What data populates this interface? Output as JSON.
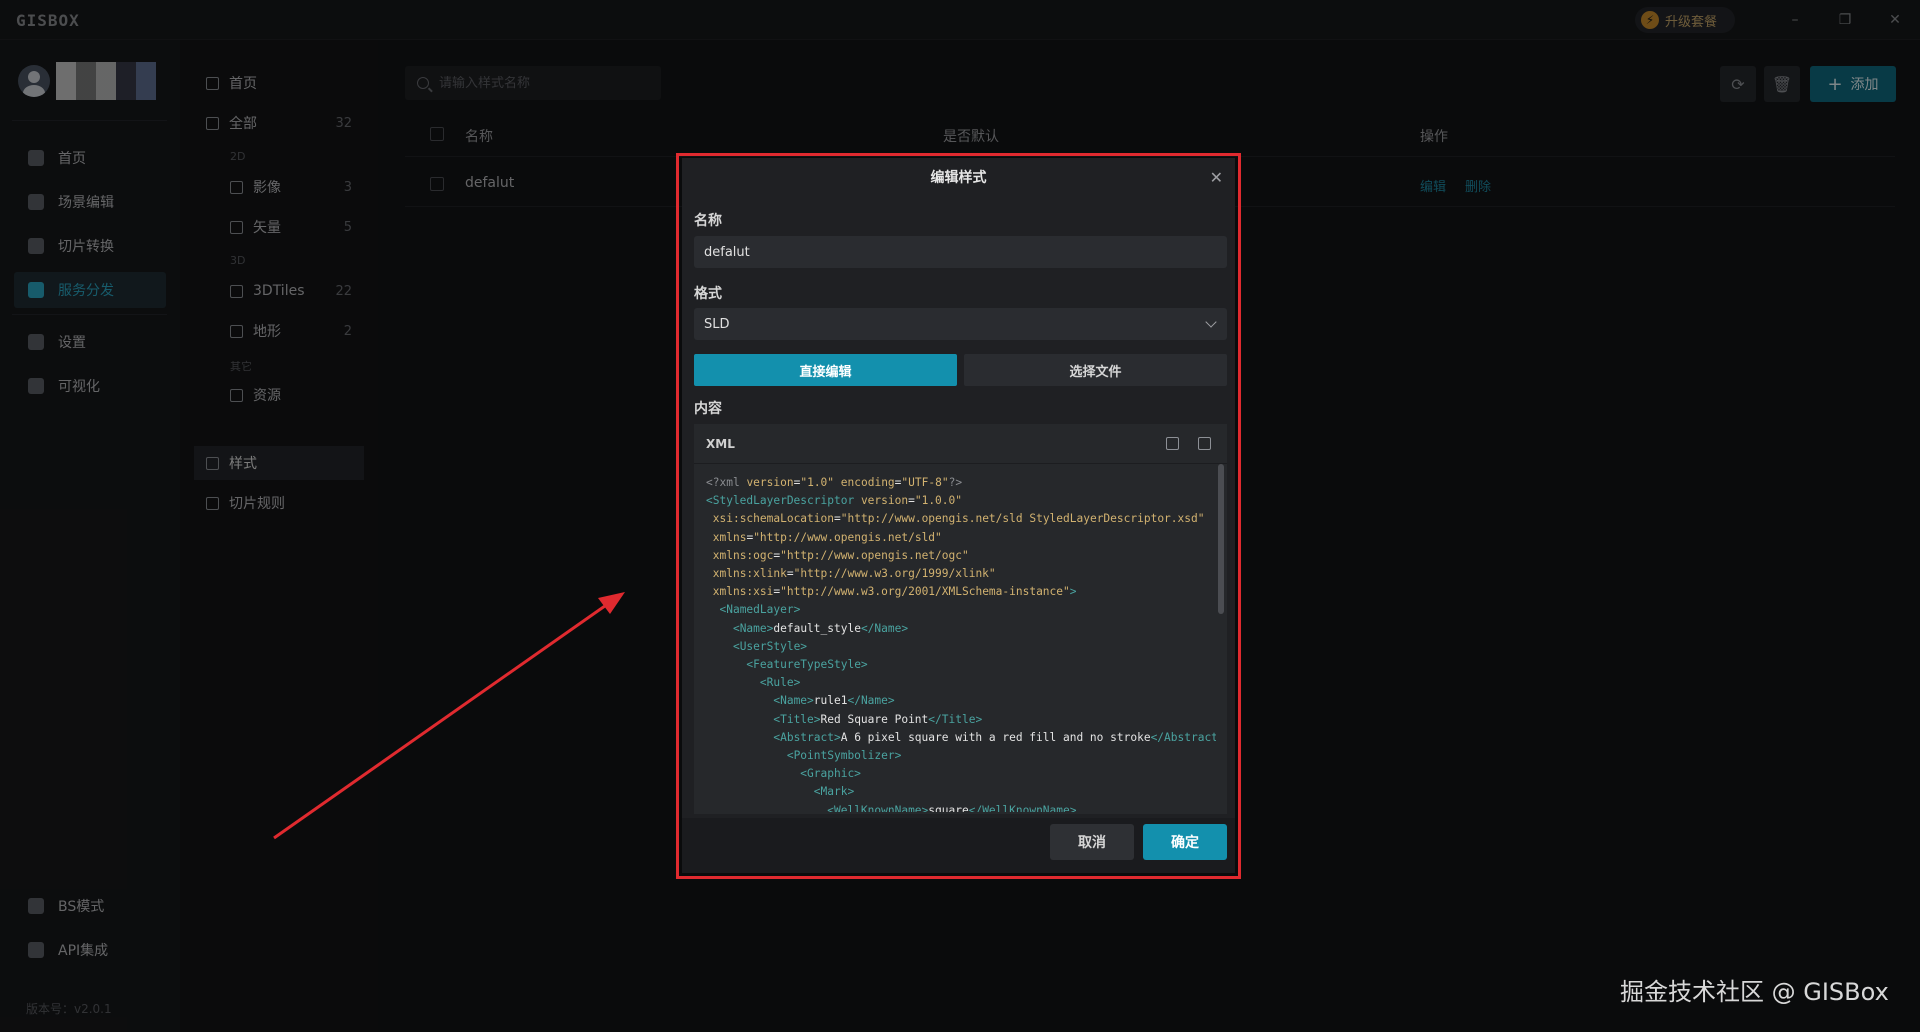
{
  "titlebar": {
    "logo": "GISBOX",
    "upgrade": "升级套餐",
    "minimize": "–",
    "restore": "❐",
    "close": "✕"
  },
  "leftnav": {
    "items": [
      {
        "label": "首页",
        "icon": "home-icon"
      },
      {
        "label": "场景编辑",
        "icon": "cube-icon"
      },
      {
        "label": "切片转换",
        "icon": "swap-icon"
      },
      {
        "label": "服务分发",
        "icon": "upload-icon",
        "active": true
      },
      {
        "label": "设置",
        "icon": "gear-icon"
      },
      {
        "label": "可视化",
        "icon": "chart-icon"
      }
    ],
    "bottom": [
      {
        "label": "BS模式",
        "icon": "code-icon"
      },
      {
        "label": "API集成",
        "icon": "link-icon"
      }
    ],
    "version": "版本号：v2.0.1"
  },
  "panel2": {
    "home": "首页",
    "all": {
      "label": "全部",
      "count": "32"
    },
    "group_2d": "2D",
    "imagery": {
      "label": "影像",
      "count": "3"
    },
    "vector": {
      "label": "矢量",
      "count": "5"
    },
    "group_3d": "3D",
    "tiles3d": {
      "label": "3DTiles",
      "count": "22"
    },
    "terrain": {
      "label": "地形",
      "count": "2"
    },
    "group_other": "其它",
    "resource": {
      "label": "资源"
    },
    "style": "样式",
    "tile_rules": "切片规则"
  },
  "main": {
    "search_placeholder": "请输入样式名称",
    "add_label": "添加",
    "columns": {
      "name": "名称",
      "default": "是否默认",
      "actions": "操作"
    },
    "rows": [
      {
        "name": "defalut",
        "edit": "编辑",
        "delete": "删除"
      }
    ]
  },
  "dialog": {
    "title": "编辑样式",
    "name_label": "名称",
    "name_value": "defalut",
    "format_label": "格式",
    "format_value": "SLD",
    "tab_direct": "直接编辑",
    "tab_file": "选择文件",
    "content_label": "内容",
    "editor_lang": "XML",
    "cancel": "取消",
    "ok": "确定"
  },
  "watermark": "掘金技术社区 @ GISBox",
  "colors": {
    "accent": "#1390ad",
    "highlight": "#e02a2f",
    "background": "#131416"
  }
}
